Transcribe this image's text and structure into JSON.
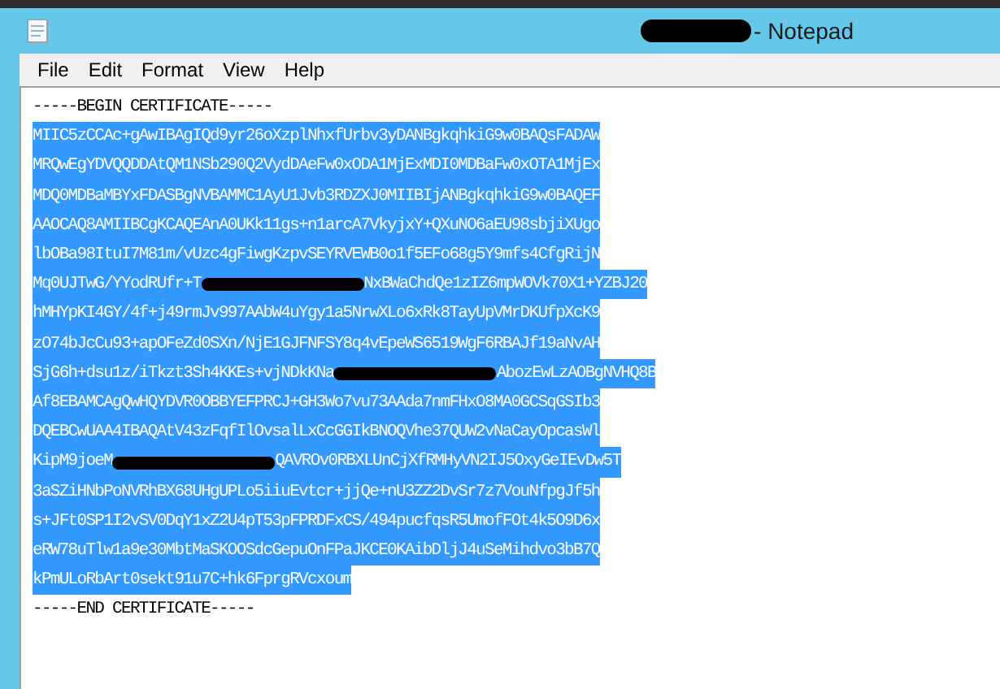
{
  "window": {
    "title": "- Notepad",
    "title_redacted": true
  },
  "menu": [
    "File",
    "Edit",
    "Format",
    "View",
    "Help"
  ],
  "document": {
    "header": "-----BEGIN CERTIFICATE-----",
    "footer": "-----END CERTIFICATE-----",
    "selected": true,
    "lines": [
      [
        {
          "kind": "text",
          "text": "MIIC5zCCAc+gAwIBAgIQd9yr26oXzplNhxfUrbv3yDANBgkqhkiG9w0BAQsFADAW"
        }
      ],
      [
        {
          "kind": "text",
          "text": "MRQwEgYDVQQDDAtQM1NSb290Q2VydDAeFw0xODA1MjExMDI0MDBaFw0xOTA1MjEx"
        }
      ],
      [
        {
          "kind": "text",
          "text": "MDQ0MDBaMBYxFDASBgNVBAMMC1AyU1Jvb3RDZXJ0MIIBIjANBgkqhkiG9w0BAQEF"
        }
      ],
      [
        {
          "kind": "text",
          "text": "AAOCAQ8AMIIBCgKCAQEAnA0UKk11gs+n1arcA7VkyjxY+QXuNO6aEU98sbjiXUgo"
        }
      ],
      [
        {
          "kind": "text",
          "text": "lbOBa98ItuI7M81m/vUzc4gFiwgKzpvSEYRVEWB0o1f5EFo68g5Y9mfs4CfgRijN"
        }
      ],
      [
        {
          "kind": "text",
          "text": "Mq0UJTwG/YYodRUfr+T"
        },
        {
          "kind": "redaction"
        },
        {
          "kind": "text",
          "text": "NxBWaChdQe1zIZ6mpWOVk70X1+YZBJ20"
        }
      ],
      [
        {
          "kind": "text",
          "text": "hMHYpKI4GY/4f+j49rmJv997AAbW4uYgy1a5NrwXLo6xRk8TayUpVMrDKUfpXcK9"
        }
      ],
      [
        {
          "kind": "text",
          "text": "zO74bJcCu93+apOFeZd0SXn/NjE1GJFNFSY8q4vEpeWS6519WgF6RBAJf19aNvAH"
        }
      ],
      [
        {
          "kind": "text",
          "text": "SjG6h+dsu1z/iTkzt3Sh4KKEs+vjNDkKNa"
        },
        {
          "kind": "redaction"
        },
        {
          "kind": "text",
          "text": "AbozEwLzAOBgNVHQ8B"
        }
      ],
      [
        {
          "kind": "text",
          "text": "Af8EBAMCAgQwHQYDVR0OBBYEFPRCJ+GH3Wo7vu73AAda7nmFHxO8MA0GCSqGSIb3"
        }
      ],
      [
        {
          "kind": "text",
          "text": "DQEBCwUAA4IBAQAtV43zFqfIlOvsalLxCcGGIkBNOQVhe37QUW2vNaCayOpcasWl"
        }
      ],
      [
        {
          "kind": "text",
          "text": "KipM9joeM"
        },
        {
          "kind": "redaction"
        },
        {
          "kind": "text",
          "text": "QAVROv0RBXLUnCjXfRMHyVN2IJ5OxyGeIEvDw5T"
        }
      ],
      [
        {
          "kind": "text",
          "text": "3aSZiHNbPoNVRhBX68UHgUPLo5iiuEvtcr+jjQe+nU3ZZ2DvSr7z7VouNfpgJf5h"
        }
      ],
      [
        {
          "kind": "text",
          "text": "s+JFt0SP1I2vSV0DqY1xZ2U4pT53pFPRDFxCS/494pucfqsR5UmofFOt4k5O9D6x"
        }
      ],
      [
        {
          "kind": "text",
          "text": "eRW78uTlw1a9e30MbtMaSKOOSdcGepuOnFPaJKCE0KAibDljJ4uSeMihdvo3bB7Q"
        }
      ],
      [
        {
          "kind": "text",
          "text": "kPmULoRbArt0sekt91u7C+hk6FprgRVcxoum"
        }
      ]
    ]
  }
}
